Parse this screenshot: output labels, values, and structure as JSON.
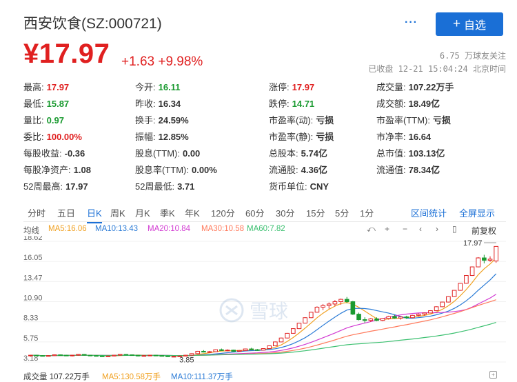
{
  "header": {
    "name": "西安饮食(SZ:000721)",
    "more": "···",
    "follow_label": "自选",
    "price": "¥17.97",
    "change": "+1.63 +9.98%",
    "followers": "6.75 万球友关注",
    "status": "已收盘 12-21 15:04:24 北京时间"
  },
  "quote": [
    {
      "label": "最高:",
      "value": "17.97",
      "cls": "red"
    },
    {
      "label": "今开:",
      "value": "16.11",
      "cls": "green"
    },
    {
      "label": "涨停:",
      "value": "17.97",
      "cls": "red"
    },
    {
      "label": "成交量:",
      "value": "107.22万手",
      "cls": "dark"
    },
    {
      "label": "最低:",
      "value": "15.87",
      "cls": "green"
    },
    {
      "label": "昨收:",
      "value": "16.34",
      "cls": "dark"
    },
    {
      "label": "跌停:",
      "value": "14.71",
      "cls": "green"
    },
    {
      "label": "成交额:",
      "value": "18.49亿",
      "cls": "dark"
    },
    {
      "label": "量比:",
      "value": "0.97",
      "cls": "green"
    },
    {
      "label": "换手:",
      "value": "24.59%",
      "cls": "dark"
    },
    {
      "label": "市盈率(动):",
      "value": "亏损",
      "cls": "dark"
    },
    {
      "label": "市盈率(TTM):",
      "value": "亏损",
      "cls": "dark"
    },
    {
      "label": "委比:",
      "value": "100.00%",
      "cls": "red"
    },
    {
      "label": "振幅:",
      "value": "12.85%",
      "cls": "dark"
    },
    {
      "label": "市盈率(静):",
      "value": "亏损",
      "cls": "dark"
    },
    {
      "label": "市净率:",
      "value": "16.64",
      "cls": "dark"
    },
    {
      "label": "每股收益:",
      "value": "-0.36",
      "cls": "dark"
    },
    {
      "label": "股息(TTM):",
      "value": "0.00",
      "cls": "dark"
    },
    {
      "label": "总股本:",
      "value": "5.74亿",
      "cls": "dark"
    },
    {
      "label": "总市值:",
      "value": "103.13亿",
      "cls": "dark"
    },
    {
      "label": "每股净资产:",
      "value": "1.08",
      "cls": "dark"
    },
    {
      "label": "股息率(TTM):",
      "value": "0.00%",
      "cls": "dark"
    },
    {
      "label": "流通股:",
      "value": "4.36亿",
      "cls": "dark"
    },
    {
      "label": "流通值:",
      "value": "78.34亿",
      "cls": "dark"
    },
    {
      "label": "52周最高:",
      "value": "17.97",
      "cls": "dark"
    },
    {
      "label": "52周最低:",
      "value": "3.71",
      "cls": "dark"
    },
    {
      "label": "货币单位:",
      "value": "CNY",
      "cls": "dark"
    }
  ],
  "tabs": [
    "分时",
    "五日",
    "日K",
    "周K",
    "月K",
    "季K",
    "年K",
    "120分",
    "60分",
    "30分",
    "15分",
    "5分",
    "1分"
  ],
  "active_tab": "日K",
  "links": {
    "range_stats": "区间统计",
    "fullscreen": "全屏显示"
  },
  "ma": {
    "label": "均线",
    "items": [
      {
        "text": "MA5:16.06",
        "color": "#f0a020"
      },
      {
        "text": "MA10:13.43",
        "color": "#2b7bd6"
      },
      {
        "text": "MA20:10.84",
        "color": "#d23ad2"
      },
      {
        "text": "MA30:10.58",
        "color": "#ff7a5c"
      },
      {
        "text": "MA60:7.82",
        "color": "#3cc070"
      }
    ]
  },
  "toolbar": {
    "fq_label": "前复权"
  },
  "volume_bar": {
    "vol": "成交量 107.22万手",
    "ma5": "MA5:130.58万手",
    "ma10": "MA10:111.37万手",
    "ma5_color": "#f0a020",
    "ma10_color": "#2b7bd6"
  },
  "watermark": "雪球",
  "chart_data": {
    "type": "candlestick",
    "y_ticks": [
      "18.62",
      "16.05",
      "13.47",
      "10.90",
      "8.33",
      "5.75",
      "3.18"
    ],
    "ylim": [
      3.18,
      18.62
    ],
    "annotations": {
      "high_label": "17.97",
      "low_label": "3.85"
    },
    "candles": [
      [
        4.0,
        4.1,
        3.9,
        4.05
      ],
      [
        4.05,
        4.1,
        3.95,
        4.0
      ],
      [
        4.0,
        4.05,
        3.9,
        3.95
      ],
      [
        3.95,
        4.05,
        3.9,
        4.0
      ],
      [
        4.0,
        4.15,
        3.95,
        4.1
      ],
      [
        4.1,
        4.15,
        4.0,
        4.05
      ],
      [
        4.05,
        4.1,
        3.95,
        4.0
      ],
      [
        4.0,
        4.1,
        3.9,
        4.05
      ],
      [
        4.05,
        4.2,
        4.0,
        4.15
      ],
      [
        4.15,
        4.2,
        4.0,
        4.05
      ],
      [
        4.05,
        4.1,
        3.95,
        4.0
      ],
      [
        4.0,
        4.05,
        3.9,
        3.95
      ],
      [
        3.95,
        4.0,
        3.85,
        3.9
      ],
      [
        3.9,
        4.0,
        3.85,
        3.95
      ],
      [
        3.95,
        4.1,
        3.9,
        4.05
      ],
      [
        4.05,
        4.2,
        4.0,
        4.15
      ],
      [
        4.15,
        4.2,
        4.05,
        4.1
      ],
      [
        4.1,
        4.15,
        4.0,
        4.05
      ],
      [
        4.05,
        4.1,
        3.9,
        3.95
      ],
      [
        3.95,
        4.05,
        3.9,
        4.0
      ],
      [
        4.0,
        4.1,
        3.95,
        4.05
      ],
      [
        4.05,
        4.1,
        3.95,
        4.0
      ],
      [
        4.0,
        4.05,
        3.9,
        3.95
      ],
      [
        3.95,
        4.0,
        3.85,
        3.9
      ],
      [
        3.9,
        3.95,
        3.85,
        3.9
      ],
      [
        3.9,
        4.0,
        3.85,
        3.95
      ],
      [
        3.95,
        4.1,
        3.9,
        4.05
      ],
      [
        4.05,
        4.3,
        4.0,
        4.25
      ],
      [
        4.25,
        4.6,
        4.2,
        4.55
      ],
      [
        4.55,
        4.7,
        4.4,
        4.45
      ],
      [
        4.45,
        4.6,
        4.35,
        4.5
      ],
      [
        4.5,
        4.8,
        4.45,
        4.75
      ],
      [
        4.75,
        4.9,
        4.6,
        4.65
      ],
      [
        4.65,
        4.8,
        4.55,
        4.7
      ],
      [
        4.7,
        4.75,
        4.5,
        4.55
      ],
      [
        4.55,
        4.7,
        4.5,
        4.65
      ],
      [
        4.65,
        4.9,
        4.6,
        4.85
      ],
      [
        4.85,
        5.0,
        4.7,
        4.75
      ],
      [
        4.75,
        4.85,
        4.6,
        4.7
      ],
      [
        4.7,
        4.95,
        4.65,
        4.9
      ],
      [
        4.9,
        5.3,
        4.85,
        5.25
      ],
      [
        5.25,
        5.8,
        5.2,
        5.75
      ],
      [
        5.75,
        6.3,
        5.7,
        6.25
      ],
      [
        6.25,
        6.9,
        6.2,
        6.85
      ],
      [
        6.85,
        7.5,
        6.8,
        7.45
      ],
      [
        7.45,
        8.2,
        7.4,
        8.15
      ],
      [
        8.15,
        8.9,
        8.1,
        8.85
      ],
      [
        8.85,
        9.6,
        8.8,
        9.55
      ],
      [
        9.55,
        10.3,
        9.5,
        10.2
      ],
      [
        10.2,
        10.6,
        9.8,
        10.4
      ],
      [
        10.4,
        10.8,
        10.0,
        10.6
      ],
      [
        10.6,
        11.1,
        10.3,
        10.9
      ],
      [
        10.9,
        11.3,
        10.5,
        11.2
      ],
      [
        11.2,
        11.5,
        10.7,
        10.9
      ],
      [
        10.9,
        11.0,
        9.2,
        9.3
      ],
      [
        9.3,
        9.5,
        8.5,
        8.6
      ],
      [
        8.6,
        8.9,
        8.2,
        8.5
      ],
      [
        8.5,
        8.8,
        8.3,
        8.7
      ],
      [
        8.7,
        8.9,
        8.4,
        8.5
      ],
      [
        8.5,
        8.8,
        8.4,
        8.75
      ],
      [
        8.75,
        9.1,
        8.6,
        9.0
      ],
      [
        9.0,
        9.2,
        8.7,
        8.8
      ],
      [
        8.8,
        9.0,
        8.6,
        8.95
      ],
      [
        8.95,
        9.1,
        8.7,
        8.85
      ],
      [
        8.85,
        9.2,
        8.8,
        9.15
      ],
      [
        9.15,
        9.4,
        9.0,
        9.3
      ],
      [
        9.3,
        9.5,
        9.1,
        9.45
      ],
      [
        9.45,
        9.8,
        9.4,
        9.75
      ],
      [
        9.75,
        10.3,
        9.7,
        10.25
      ],
      [
        10.25,
        10.9,
        10.2,
        10.85
      ],
      [
        10.85,
        11.6,
        10.8,
        11.55
      ],
      [
        11.55,
        12.4,
        11.5,
        12.35
      ],
      [
        12.35,
        13.3,
        12.3,
        13.25
      ],
      [
        13.25,
        14.3,
        13.2,
        14.25
      ],
      [
        14.25,
        15.4,
        14.2,
        15.35
      ],
      [
        15.35,
        16.6,
        15.3,
        16.5
      ],
      [
        16.5,
        16.9,
        15.8,
        16.2
      ],
      [
        16.2,
        16.7,
        16.0,
        16.34
      ],
      [
        16.11,
        17.97,
        15.87,
        17.97
      ]
    ]
  }
}
